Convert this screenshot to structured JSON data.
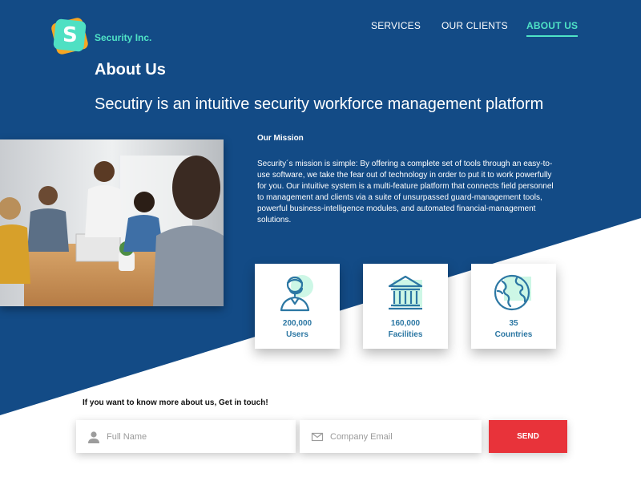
{
  "brand": {
    "name": "Security Inc.",
    "logo_letter": "S"
  },
  "nav": {
    "items": [
      "SERVICES",
      "OUR CLIENTS",
      "ABOUT US"
    ],
    "active": "ABOUT US"
  },
  "page": {
    "title": "About Us",
    "subtitle": "Secutiry is an intuitive security workforce management platform"
  },
  "mission": {
    "heading": "Our Mission",
    "text": "Security´s mission is simple: By offering a complete set of tools through an easy-to-use software, we take the fear out of technology in order to put it to work powerfully for you. Our intuitive system is a multi-feature platform that connects field personnel to management and clients via a suite of unsurpassed guard-management tools, powerful business-intelligence modules, and automated financial-management solutions."
  },
  "stats": [
    {
      "value": "200,000",
      "label": "Users",
      "icon": "user-headset-icon"
    },
    {
      "value": "160,000",
      "label": "Facilities",
      "icon": "bank-building-icon"
    },
    {
      "value": "35",
      "label": "Countries",
      "icon": "globe-icon"
    }
  ],
  "contact": {
    "heading": "If you want to know more about us, Get in touch!",
    "name_placeholder": "Full Name",
    "email_placeholder": "Company Email",
    "send_label": "SEND"
  },
  "colors": {
    "primary_blue": "#134b86",
    "accent_teal": "#4fe3c6",
    "icon_blue": "#2c77a3",
    "icon_mint": "#cdf7e6",
    "send_red": "#e8333a",
    "logo_orange": "#f6a623"
  }
}
